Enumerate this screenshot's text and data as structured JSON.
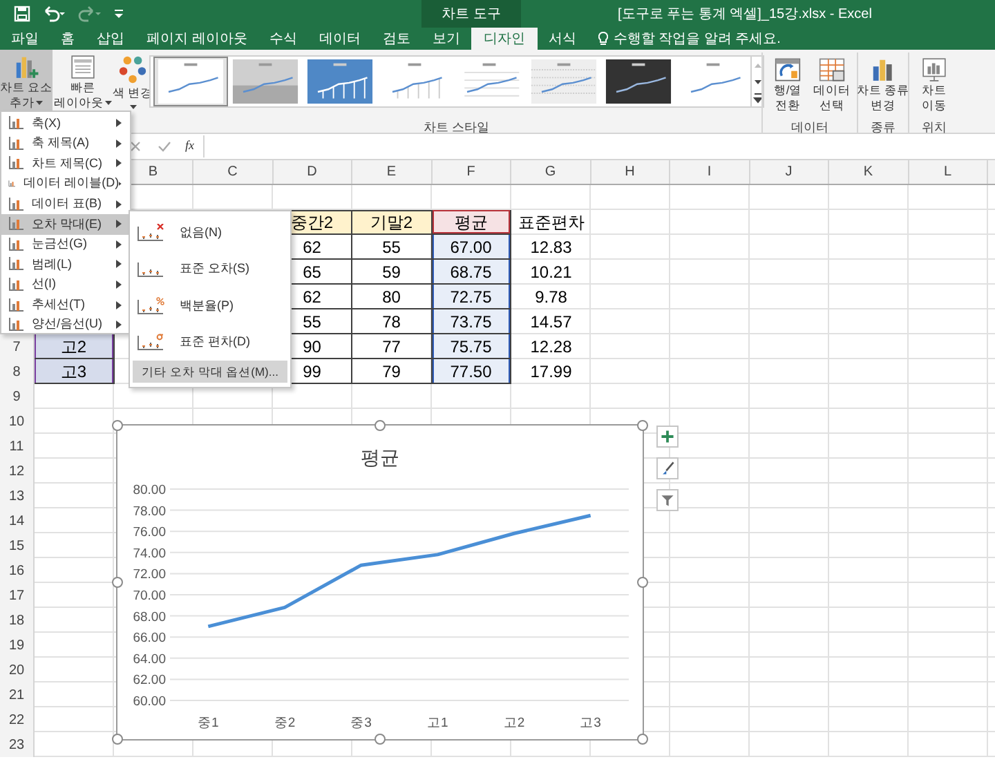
{
  "title_bar": {
    "contextual_group": "차트 도구",
    "title": "[도구로 푸는 통계 엑셀]_15강.xlsx - Excel"
  },
  "ribbon_tabs": [
    {
      "label": "파일",
      "selected": false
    },
    {
      "label": "홈",
      "selected": false
    },
    {
      "label": "삽입",
      "selected": false
    },
    {
      "label": "페이지 레이아웃",
      "selected": false
    },
    {
      "label": "수식",
      "selected": false
    },
    {
      "label": "데이터",
      "selected": false
    },
    {
      "label": "검토",
      "selected": false
    },
    {
      "label": "보기",
      "selected": false
    },
    {
      "label": "디자인",
      "selected": true
    },
    {
      "label": "서식",
      "selected": false
    }
  ],
  "tell_me": {
    "placeholder": "수행할 작업을 알려 주세요."
  },
  "ribbon": {
    "layout_buttons": [
      {
        "kind": "add_element",
        "lines": [
          "차트 요소",
          "추가"
        ],
        "pressed": true,
        "dropdown": true
      },
      {
        "kind": "quick_layout",
        "lines": [
          "빠른",
          "레이아웃"
        ],
        "pressed": false,
        "dropdown": true
      },
      {
        "kind": "colors",
        "lines": [
          "색 변경"
        ],
        "pressed": false,
        "dropdown": true
      }
    ],
    "chart_styles": {
      "label": "차트 스타일",
      "styles": [
        {
          "kind": "plain",
          "selected": true
        },
        {
          "kind": "gradient",
          "selected": false
        },
        {
          "kind": "blue",
          "selected": false
        },
        {
          "kind": "droplines",
          "selected": false
        },
        {
          "kind": "grid",
          "selected": false
        },
        {
          "kind": "pattern",
          "selected": false
        },
        {
          "kind": "dark",
          "selected": false
        },
        {
          "kind": "plain",
          "selected": false
        }
      ]
    },
    "groups": [
      {
        "label": "데이터",
        "buttons": [
          {
            "kind": "switch",
            "lines": [
              "행/열",
              "전환"
            ]
          },
          {
            "kind": "select_data",
            "lines": [
              "데이터",
              "선택"
            ]
          }
        ]
      },
      {
        "label": "종류",
        "buttons": [
          {
            "kind": "chart_type",
            "lines": [
              "차트 종류",
              "변경"
            ]
          }
        ]
      },
      {
        "label": "위치",
        "buttons": [
          {
            "kind": "move",
            "lines": [
              "차트",
              "이동"
            ]
          }
        ]
      }
    ]
  },
  "formula_bar": {
    "function_button": "fx"
  },
  "sheet": {
    "columns": [
      "B",
      "C",
      "D",
      "E",
      "F",
      "G",
      "H",
      "I",
      "J",
      "K",
      "L"
    ],
    "rows": [
      {},
      {
        "cells": [
          null,
          null,
          null,
          {
            "text": "중간2",
            "kind": "header"
          },
          {
            "text": "기말2",
            "kind": "header"
          },
          {
            "text": "평균",
            "kind": "series_name"
          },
          {
            "text": "표준편차",
            "kind": "plain"
          }
        ]
      },
      {
        "cells": [
          null,
          null,
          null,
          {
            "text": "62",
            "kind": "value"
          },
          {
            "text": "55",
            "kind": "value"
          },
          {
            "text": "67.00",
            "kind": "series_value"
          },
          {
            "text": "12.83",
            "kind": "plain"
          }
        ]
      },
      {
        "cells": [
          null,
          null,
          null,
          {
            "text": "65",
            "kind": "value"
          },
          {
            "text": "59",
            "kind": "value"
          },
          {
            "text": "68.75",
            "kind": "series_value"
          },
          {
            "text": "10.21",
            "kind": "plain"
          }
        ]
      },
      {
        "cells": [
          null,
          null,
          null,
          {
            "text": "62",
            "kind": "value"
          },
          {
            "text": "80",
            "kind": "value"
          },
          {
            "text": "72.75",
            "kind": "series_value"
          },
          {
            "text": "9.78",
            "kind": "plain"
          }
        ]
      },
      {
        "cells": [
          null,
          null,
          null,
          {
            "text": "55",
            "kind": "value"
          },
          {
            "text": "78",
            "kind": "value"
          },
          {
            "text": "73.75",
            "kind": "series_value"
          },
          {
            "text": "14.57",
            "kind": "plain"
          }
        ]
      },
      {
        "number": "7",
        "cells": [
          {
            "text": "고2",
            "kind": "category"
          },
          null,
          null,
          {
            "text": "90",
            "kind": "value"
          },
          {
            "text": "77",
            "kind": "value"
          },
          {
            "text": "75.75",
            "kind": "series_value"
          },
          {
            "text": "12.28",
            "kind": "plain"
          }
        ]
      },
      {
        "number": "8",
        "cells": [
          {
            "text": "고3",
            "kind": "category"
          },
          null,
          null,
          {
            "text": "99",
            "kind": "value"
          },
          {
            "text": "79",
            "kind": "value"
          },
          {
            "text": "77.50",
            "kind": "series_value"
          },
          {
            "text": "17.99",
            "kind": "plain"
          }
        ]
      },
      {
        "number": "9"
      },
      {
        "number": "10"
      },
      {
        "number": "11"
      },
      {
        "number": "12"
      },
      {
        "number": "13"
      },
      {
        "number": "14"
      },
      {
        "number": "15"
      },
      {
        "number": "16"
      },
      {
        "number": "17"
      },
      {
        "number": "18"
      },
      {
        "number": "19"
      },
      {
        "number": "20"
      },
      {
        "number": "21"
      },
      {
        "number": "22"
      },
      {
        "number": "23"
      }
    ]
  },
  "chart_element_menu": {
    "items": [
      {
        "label": "축(X)",
        "selected": false
      },
      {
        "label": "축 제목(A)",
        "selected": false
      },
      {
        "label": "차트 제목(C)",
        "selected": false
      },
      {
        "label": "데이터 레이블(D)",
        "selected": false
      },
      {
        "label": "데이터 표(B)",
        "selected": false
      },
      {
        "label": "오차 막대(E)",
        "selected": true
      },
      {
        "label": "눈금선(G)",
        "selected": false
      },
      {
        "label": "범례(L)",
        "selected": false
      },
      {
        "label": "선(I)",
        "selected": false
      },
      {
        "label": "추세선(T)",
        "selected": false
      },
      {
        "label": "양선/음선(U)",
        "selected": false
      }
    ]
  },
  "error_bar_submenu": {
    "items": [
      {
        "kind": "none",
        "label": "없음(N)"
      },
      {
        "kind": "standard_error",
        "label": "표준 오차(S)"
      },
      {
        "kind": "percentage",
        "label": "백분율(P)"
      },
      {
        "kind": "standard_deviation",
        "label": "표준 편차(D)"
      }
    ],
    "more_options": "기타 오차 막대 옵션(M)..."
  },
  "chart": {
    "side_buttons": [
      {
        "kind": "add"
      },
      {
        "kind": "style"
      },
      {
        "kind": "filter"
      }
    ],
    "chart_data": {
      "type": "line",
      "title": "평균",
      "categories": [
        "중1",
        "중2",
        "중3",
        "고1",
        "고2",
        "고3"
      ],
      "series": [
        {
          "color": "#4a8fd6",
          "values": [
            67,
            68.8,
            72.8,
            73.8,
            75.8,
            77.5
          ]
        }
      ],
      "grid": true,
      "ylim": [
        60,
        80
      ],
      "yticks": [
        {
          "value": 60,
          "label": "60.00"
        },
        {
          "value": 62,
          "label": "62.00"
        },
        {
          "value": 64,
          "label": "64.00"
        },
        {
          "value": 66,
          "label": "66.00"
        },
        {
          "value": 68,
          "label": "68.00"
        },
        {
          "value": 70,
          "label": "70.00"
        },
        {
          "value": 72,
          "label": "72.00"
        },
        {
          "value": 74,
          "label": "74.00"
        },
        {
          "value": 76,
          "label": "76.00"
        },
        {
          "value": 78,
          "label": "78.00"
        },
        {
          "value": 80,
          "label": "80.00"
        }
      ]
    }
  }
}
